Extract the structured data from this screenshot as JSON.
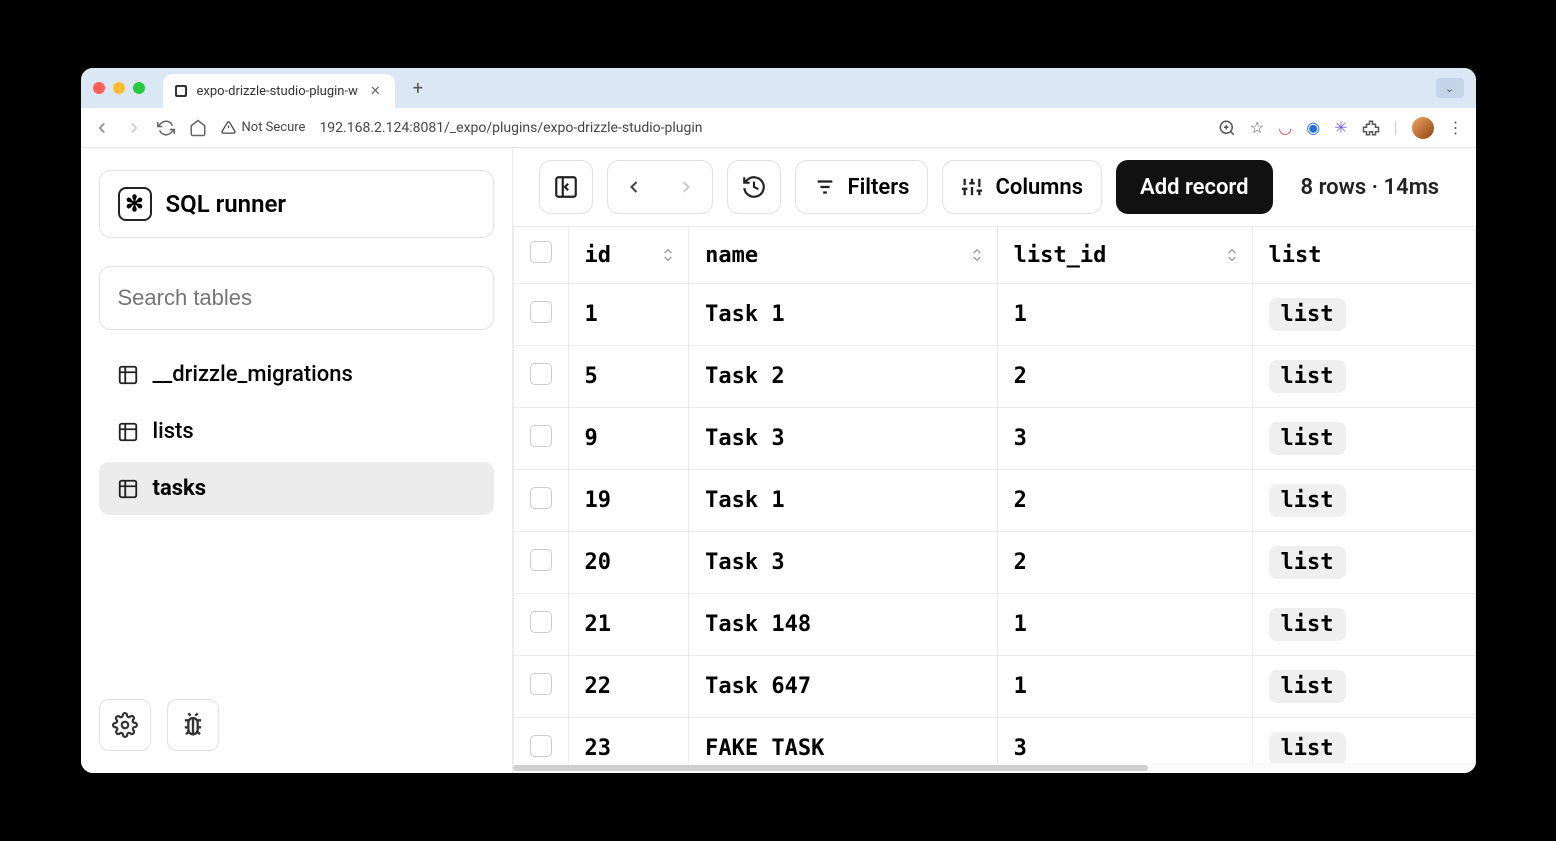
{
  "browser": {
    "tab_title": "expo-drizzle-studio-plugin-w",
    "not_secure_label": "Not Secure",
    "url": "192.168.2.124:8081/_expo/plugins/expo-drizzle-studio-plugin"
  },
  "sidebar": {
    "sql_runner_label": "SQL runner",
    "search_placeholder": "Search tables",
    "tables": [
      {
        "name": "__drizzle_migrations",
        "active": false
      },
      {
        "name": "lists",
        "active": false
      },
      {
        "name": "tasks",
        "active": true
      }
    ]
  },
  "toolbar": {
    "filters_label": "Filters",
    "columns_label": "Columns",
    "add_record_label": "Add record",
    "stats": "8 rows · 14ms"
  },
  "table": {
    "columns": [
      "id",
      "name",
      "list_id",
      "list"
    ],
    "rows": [
      {
        "id": "1",
        "name": "Task 1",
        "list_id": "1",
        "list": "list"
      },
      {
        "id": "5",
        "name": "Task 2",
        "list_id": "2",
        "list": "list"
      },
      {
        "id": "9",
        "name": "Task 3",
        "list_id": "3",
        "list": "list"
      },
      {
        "id": "19",
        "name": "Task 1",
        "list_id": "2",
        "list": "list"
      },
      {
        "id": "20",
        "name": "Task 3",
        "list_id": "2",
        "list": "list"
      },
      {
        "id": "21",
        "name": "Task 148",
        "list_id": "1",
        "list": "list"
      },
      {
        "id": "22",
        "name": "Task 647",
        "list_id": "1",
        "list": "list"
      },
      {
        "id": "23",
        "name": "FAKE TASK",
        "list_id": "3",
        "list": "list"
      }
    ]
  }
}
